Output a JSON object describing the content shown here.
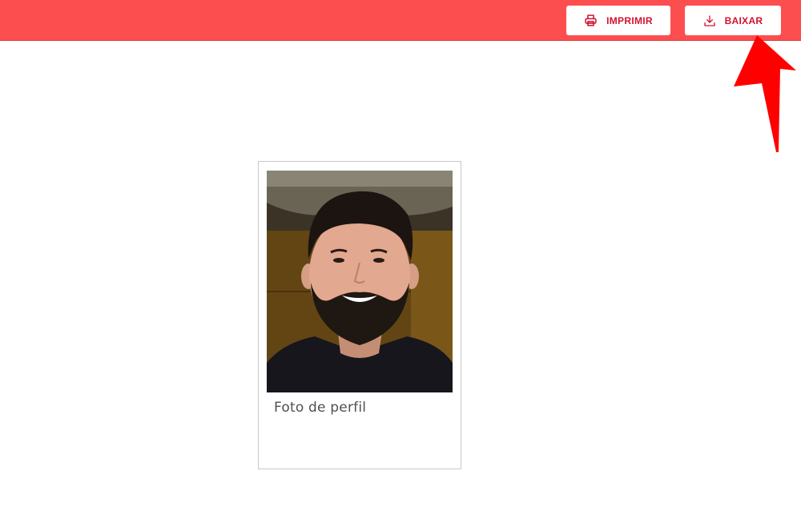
{
  "toolbar": {
    "print_label": "IMPRIMIR",
    "download_label": "BAIXAR",
    "print_icon": "printer-icon",
    "download_icon": "download-icon"
  },
  "card": {
    "caption": "Foto de perfil"
  },
  "colors": {
    "topbar": "#fd4e4f",
    "button_text": "#d3122f",
    "arrow": "#ff0000"
  }
}
